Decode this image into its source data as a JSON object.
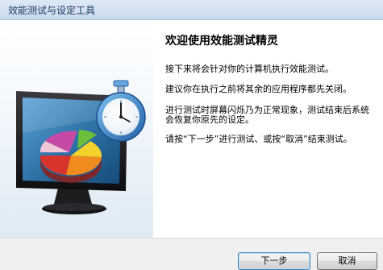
{
  "window": {
    "title": "效能测试与设定工具"
  },
  "main": {
    "heading": "欢迎使用效能测试精灵",
    "paragraphs": [
      "接下来将会针对你的计算机执行效能测试。",
      "建议你在执行之前将其余的应用程序都先关闭。",
      "进行测试时屏幕闪烁乃为正常现象，测试结束后系统会恢复你原先的设定。",
      "请按“下一步”进行测试、或按“取消”结束测试。"
    ]
  },
  "footer": {
    "next_label": "下一步",
    "cancel_label": "取消"
  },
  "illustration": {
    "icons": [
      "monitor-icon",
      "pie-chart-icon",
      "stopwatch-icon"
    ],
    "colors": {
      "bezel": "#1c1c1e",
      "screen": "#2b6fa3",
      "slice_red": "#d9342b",
      "slice_orange": "#f08c1e",
      "slice_yellow": "#f4d22c",
      "slice_green": "#6cbf3a",
      "slice_magenta": "#c64aa5",
      "stopwatch_blue": "#2a78c8"
    }
  }
}
